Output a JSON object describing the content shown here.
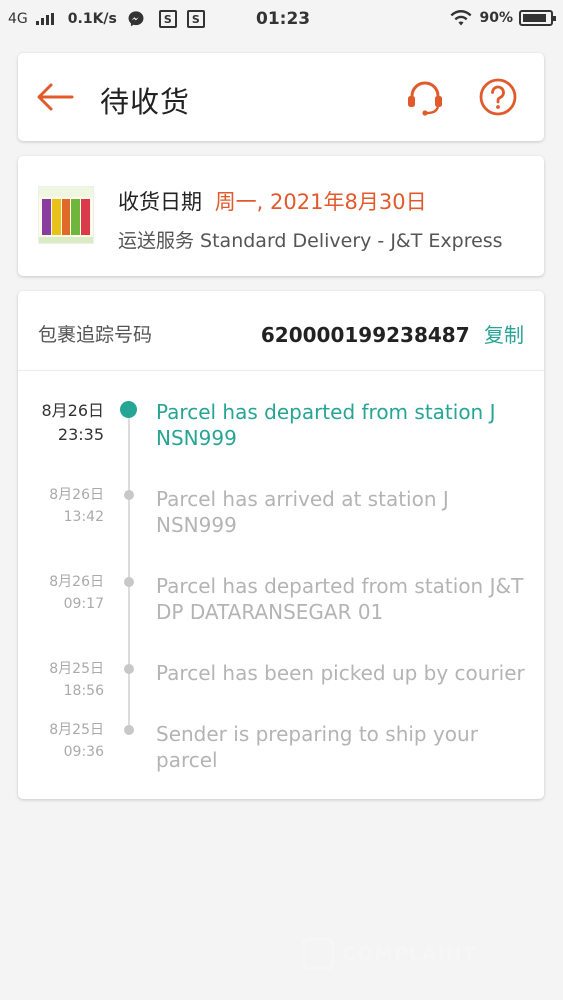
{
  "status_bar": {
    "network": "4G",
    "speed": "0.1K/s",
    "time": "01:23",
    "battery": "90%",
    "battery_level": 0.9
  },
  "header": {
    "title": "待收货"
  },
  "delivery": {
    "date_label": "收货日期",
    "date_value": "周一, 2021年8月30日",
    "shipping_line": "运送服务 Standard Delivery  - J&T Express"
  },
  "tracking": {
    "label": "包裹追踪号码",
    "number": "620000199238487",
    "copy_label": "复制",
    "events": [
      {
        "date": "8月26日",
        "time": "23:35",
        "text": "Parcel has departed from station J NSN999"
      },
      {
        "date": "8月26日",
        "time": "13:42",
        "text": "Parcel has arrived at station J NSN999"
      },
      {
        "date": "8月26日",
        "time": "09:17",
        "text": "Parcel has departed from station J&T DP DATARANSEGAR 01"
      },
      {
        "date": "8月25日",
        "time": "18:56",
        "text": "Parcel has been picked up by courier"
      },
      {
        "date": "8月25日",
        "time": "09:36",
        "text": "Sender is preparing to ship your parcel"
      }
    ]
  },
  "watermark": {
    "text": "COMPLAINT"
  },
  "colors": {
    "accent_orange": "#e15a2c",
    "accent_teal": "#26a595",
    "muted_text": "#b4b4b4"
  },
  "icons": [
    "back-arrow-icon",
    "headset-icon",
    "help-icon",
    "messenger-icon",
    "wifi-icon",
    "battery-icon"
  ]
}
